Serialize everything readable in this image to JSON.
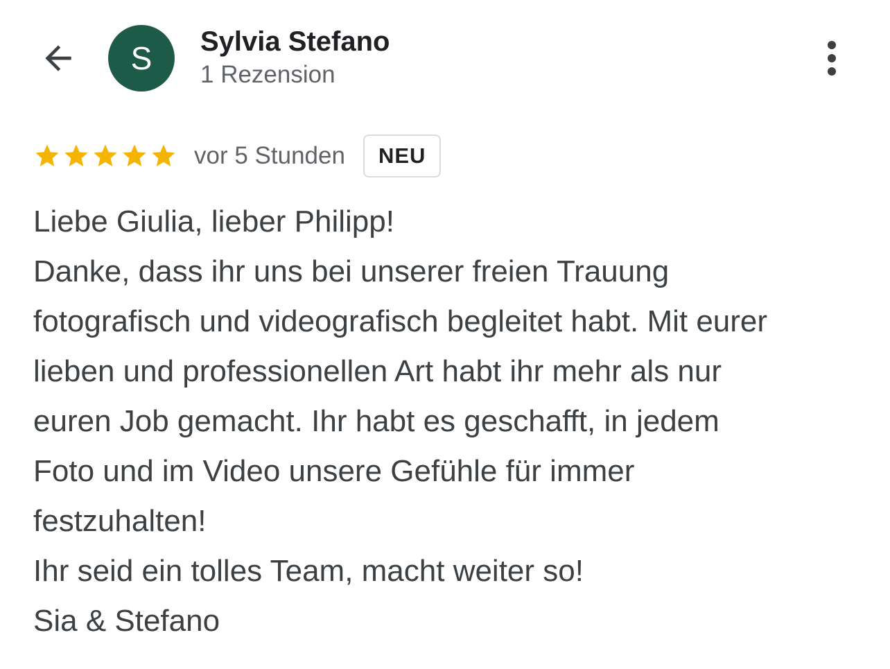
{
  "header": {
    "author_name": "Sylvia Stefano",
    "avatar_letter": "S",
    "avatar_color": "#1e5a48",
    "review_count": "1 Rezension"
  },
  "review": {
    "rating": 5,
    "max_rating": 5,
    "star_color": "#f4b400",
    "time": "vor 5 Stunden",
    "badge": "NEU",
    "lines": [
      "Liebe Giulia, lieber Philipp!",
      "Danke, dass ihr uns bei unserer freien Trauung",
      "fotografisch und videografisch begleitet habt. Mit eurer",
      "lieben und professionellen Art habt ihr mehr als nur",
      "euren Job gemacht. Ihr habt es geschafft, in jedem",
      "Foto und im Video unsere Gefühle für immer",
      "festzuhalten!",
      "Ihr seid ein tolles Team, macht weiter so!",
      "Sia & Stefano"
    ]
  },
  "icons": {
    "back": "arrow-back-icon",
    "more": "more-vertical-icon",
    "star": "star-icon"
  }
}
